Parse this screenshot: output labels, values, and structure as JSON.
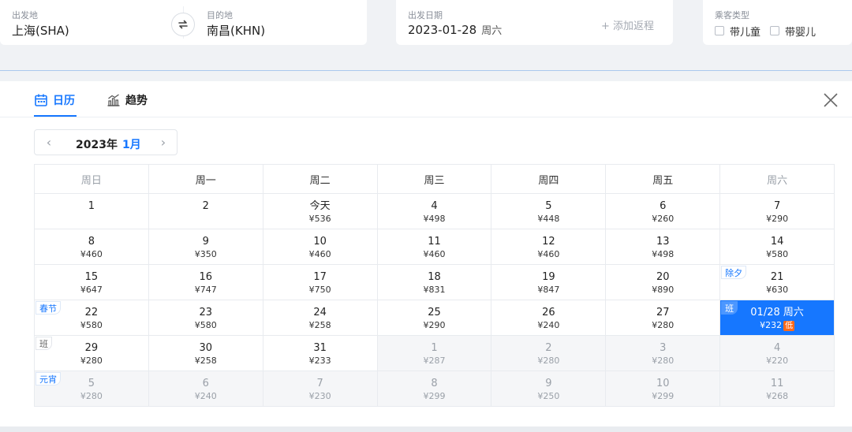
{
  "search": {
    "from_label": "出发地",
    "from_value": "上海(SHA)",
    "to_label": "目的地",
    "to_value": "南昌(KHN)",
    "date_label": "出发日期",
    "date_value": "2023-01-28",
    "date_weekday": "周六",
    "add_return": "+ 添加返程",
    "passenger_label": "乘客类型",
    "child_label": "带儿童",
    "infant_label": "带婴儿"
  },
  "tabs": {
    "calendar": "日历",
    "trend": "趋势"
  },
  "month_nav": {
    "year": "2023年",
    "month": "1月"
  },
  "weekdays": [
    "周日",
    "周一",
    "周二",
    "周三",
    "周四",
    "周五",
    "周六"
  ],
  "weeks": [
    [
      {
        "day": "1",
        "price": ""
      },
      {
        "day": "2",
        "price": ""
      },
      {
        "day": "今天",
        "price": "¥536"
      },
      {
        "day": "4",
        "price": "¥498"
      },
      {
        "day": "5",
        "price": "¥448"
      },
      {
        "day": "6",
        "price": "¥260"
      },
      {
        "day": "7",
        "price": "¥290"
      }
    ],
    [
      {
        "day": "8",
        "price": "¥460"
      },
      {
        "day": "9",
        "price": "¥350"
      },
      {
        "day": "10",
        "price": "¥460"
      },
      {
        "day": "11",
        "price": "¥460"
      },
      {
        "day": "12",
        "price": "¥460"
      },
      {
        "day": "13",
        "price": "¥498"
      },
      {
        "day": "14",
        "price": "¥580"
      }
    ],
    [
      {
        "day": "15",
        "price": "¥647"
      },
      {
        "day": "16",
        "price": "¥747"
      },
      {
        "day": "17",
        "price": "¥750"
      },
      {
        "day": "18",
        "price": "¥831"
      },
      {
        "day": "19",
        "price": "¥847"
      },
      {
        "day": "20",
        "price": "¥890"
      },
      {
        "day": "21",
        "price": "¥630",
        "tag": "除夕",
        "tag_type": "holiday"
      }
    ],
    [
      {
        "day": "22",
        "price": "¥580",
        "tag": "春节",
        "tag_type": "holiday"
      },
      {
        "day": "23",
        "price": "¥580"
      },
      {
        "day": "24",
        "price": "¥258"
      },
      {
        "day": "25",
        "price": "¥290"
      },
      {
        "day": "26",
        "price": "¥240"
      },
      {
        "day": "27",
        "price": "¥280"
      },
      {
        "day": "01/28 周六",
        "price": "¥232",
        "tag": "班",
        "tag_type": "work",
        "selected": true,
        "badge": "低"
      }
    ],
    [
      {
        "day": "29",
        "price": "¥280",
        "tag": "班",
        "tag_type": "work"
      },
      {
        "day": "30",
        "price": "¥258"
      },
      {
        "day": "31",
        "price": "¥233"
      },
      {
        "day": "1",
        "price": "¥287",
        "other": true
      },
      {
        "day": "2",
        "price": "¥280",
        "other": true
      },
      {
        "day": "3",
        "price": "¥280",
        "other": true
      },
      {
        "day": "4",
        "price": "¥220",
        "other": true
      }
    ],
    [
      {
        "day": "5",
        "price": "¥280",
        "other": true,
        "tag": "元宵",
        "tag_type": "holiday"
      },
      {
        "day": "6",
        "price": "¥240",
        "other": true
      },
      {
        "day": "7",
        "price": "¥230",
        "other": true
      },
      {
        "day": "8",
        "price": "¥299",
        "other": true
      },
      {
        "day": "9",
        "price": "¥250",
        "other": true
      },
      {
        "day": "10",
        "price": "¥299",
        "other": true
      },
      {
        "day": "11",
        "price": "¥268",
        "other": true
      }
    ]
  ],
  "colors": {
    "accent": "#1677ff",
    "low_badge": "#ff6a1a"
  },
  "icons": {
    "swap": "swap-arrows-icon",
    "calendar": "calendar-icon",
    "trend": "bar-trend-icon",
    "close": "close-icon"
  }
}
